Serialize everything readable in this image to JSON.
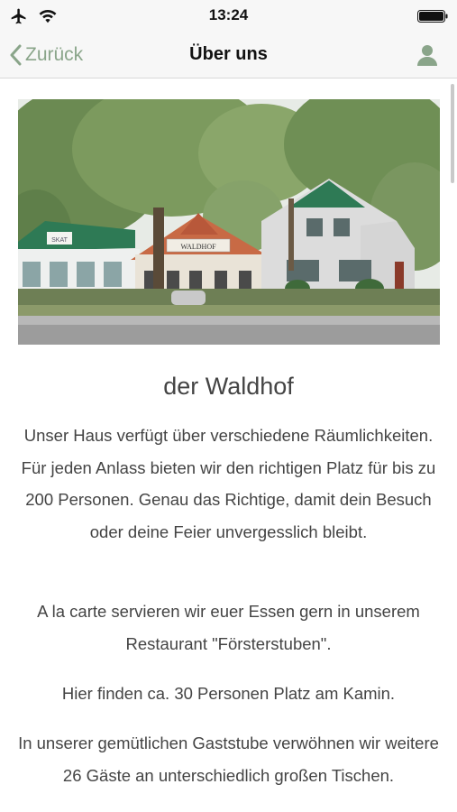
{
  "status_bar": {
    "time": "13:24"
  },
  "nav": {
    "back_label": "Zurück",
    "title": "Über uns"
  },
  "hero": {
    "sign_text": "WALDHOF",
    "sign_small": "SKAT"
  },
  "content": {
    "heading": "der Waldhof",
    "paragraphs": [
      "Unser Haus verfügt über verschiedene Räumlichkeiten. Für jeden Anlass bieten wir den richtigen Platz für bis zu 200 Personen. Genau das Richtige, damit dein Besuch oder deine Feier unvergesslich bleibt.",
      "A la carte servieren wir euer Essen gern in unserem Restaurant \"Försterstuben\".",
      "Hier finden ca. 30 Personen Platz am Kamin.",
      "In unserer gemütlichen Gaststube verwöhnen wir weitere 26 Gäste an unterschiedlich großen Tischen."
    ]
  },
  "colors": {
    "accent": "#8aa58a",
    "text": "#444444",
    "bar": "#f7f7f7"
  }
}
